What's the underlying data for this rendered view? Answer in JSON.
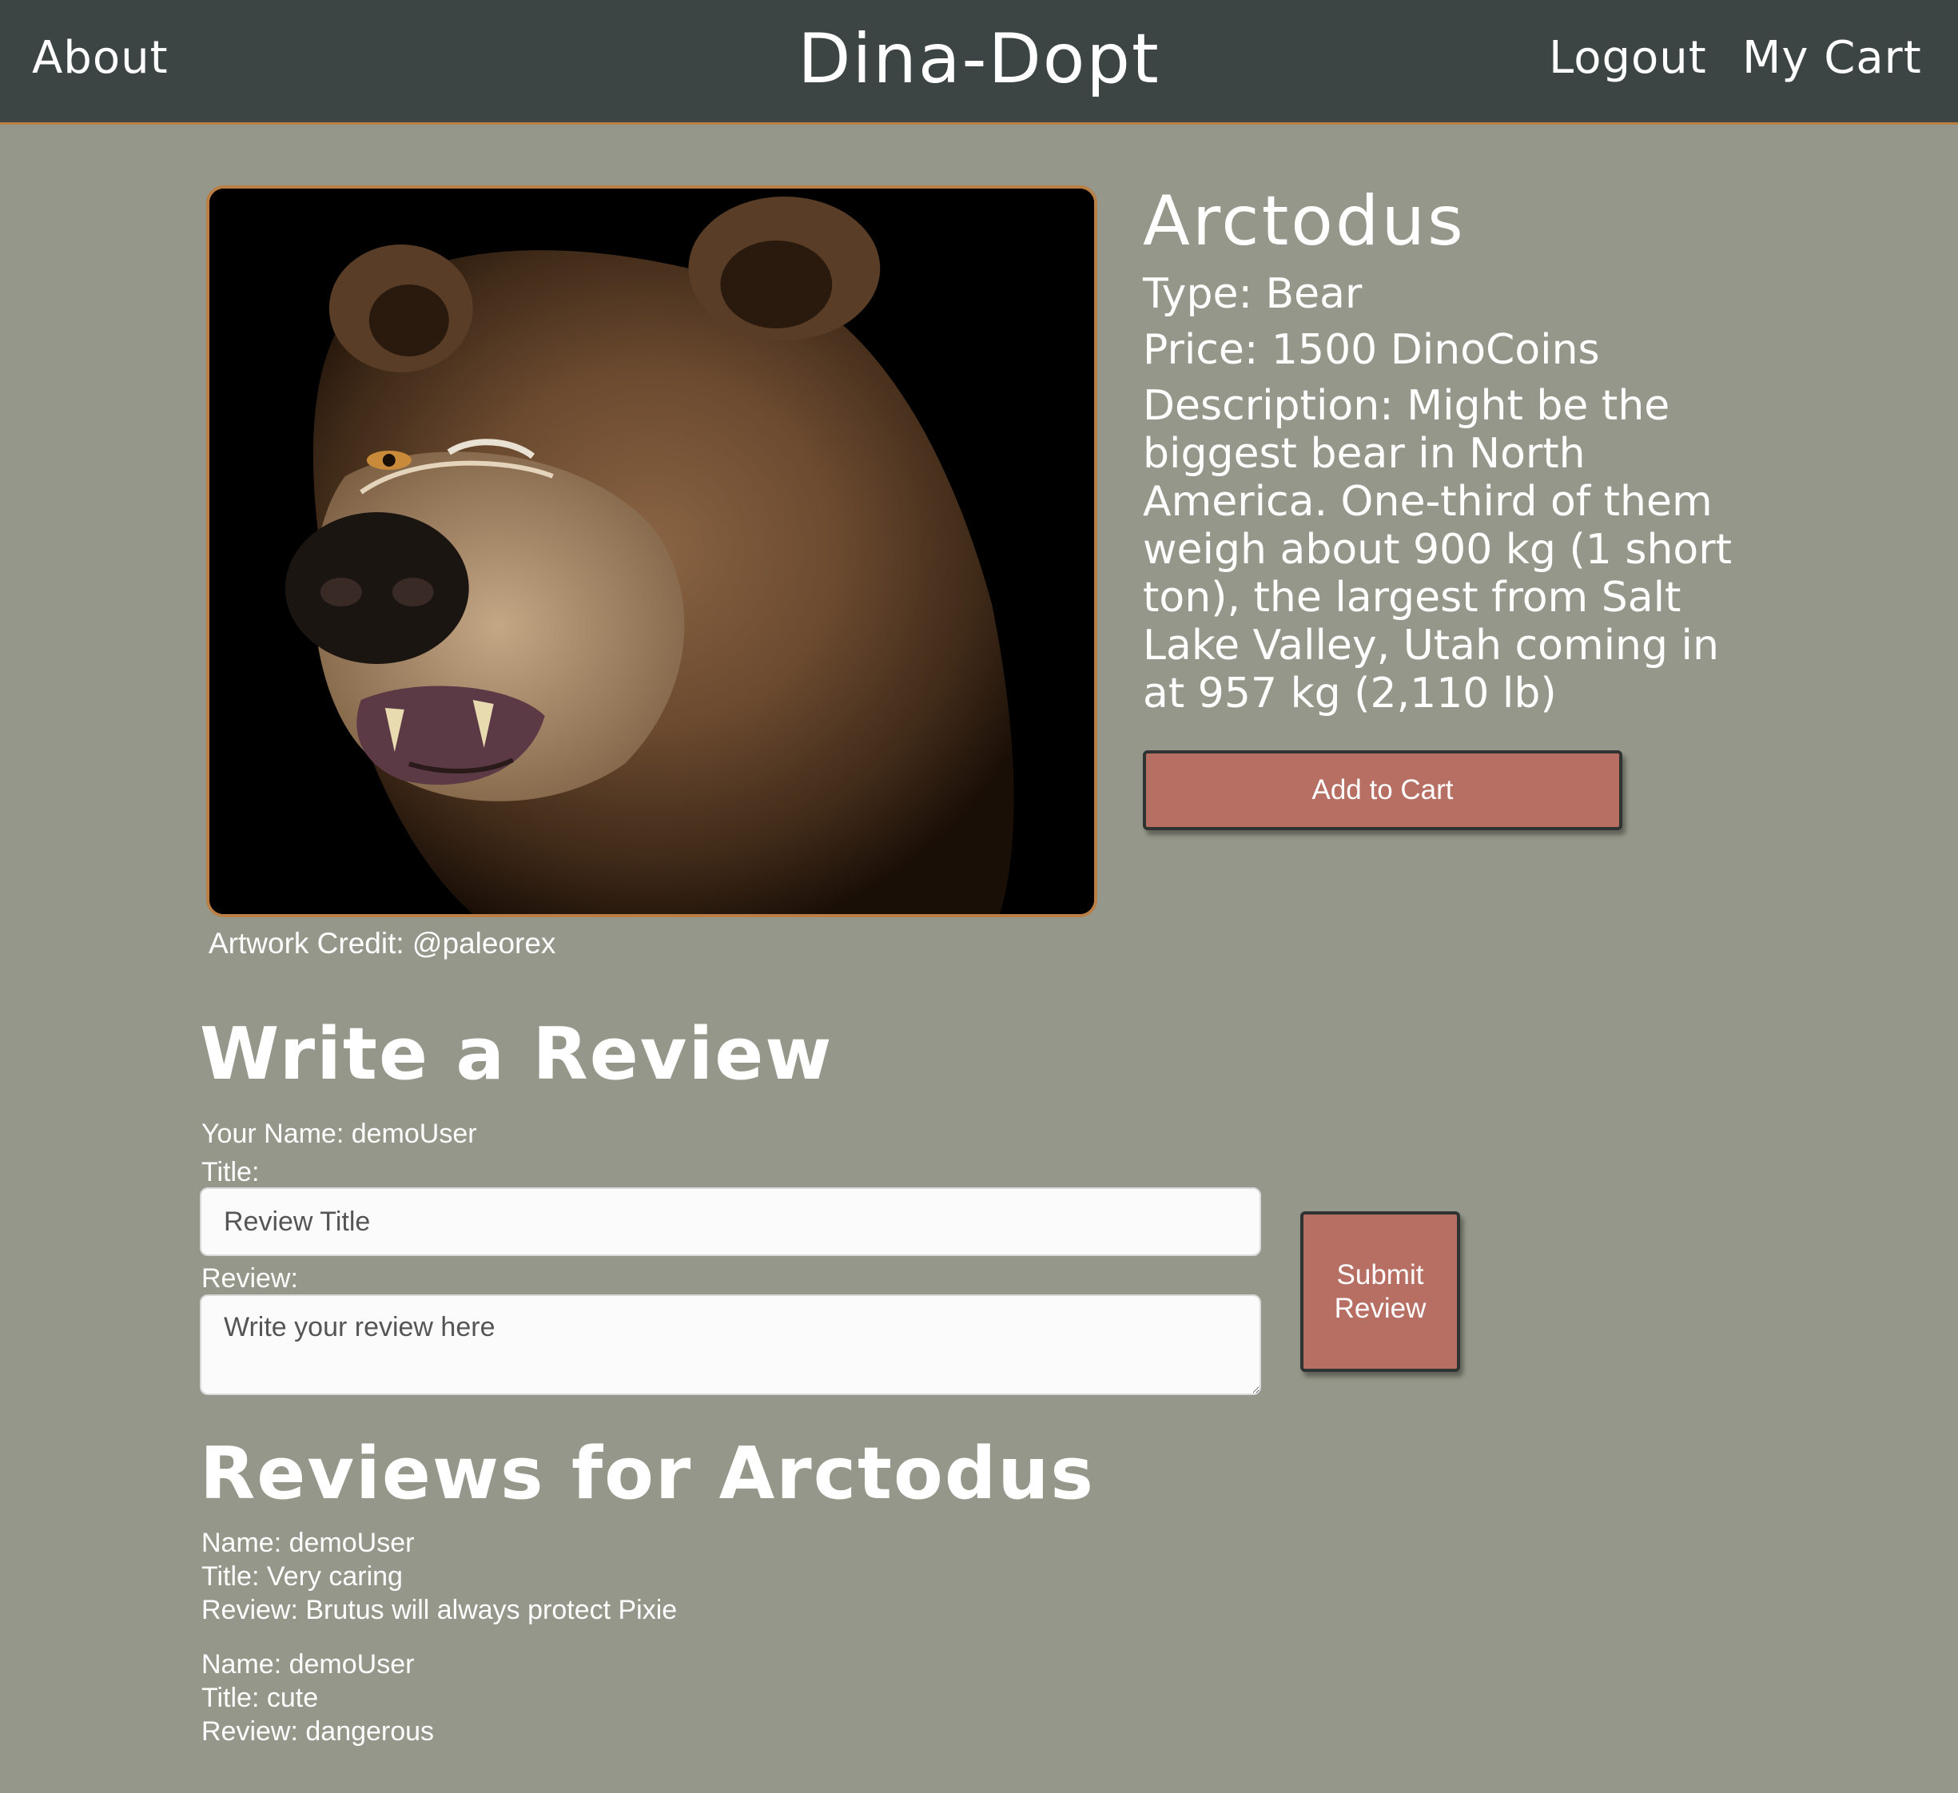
{
  "nav": {
    "about": "About",
    "brand": "Dina-Dopt",
    "logout": "Logout",
    "cart": "My Cart"
  },
  "dino": {
    "name": "Arctodus",
    "type": "Type: Bear",
    "price": "Price: 1500 DinoCoins",
    "description": "Description: Might be the biggest bear in North America. One-third of them weigh about 900 kg (1 short ton), the largest from Salt Lake Valley, Utah coming in at 957 kg (2,110 lb)",
    "credit": "Artwork Credit: @paleorex",
    "add_to_cart": "Add to Cart"
  },
  "review_form": {
    "heading": "Write a Review",
    "your_name": "Your Name: demoUser",
    "title_label": "Title:",
    "title_placeholder": "Review Title",
    "review_label": "Review:",
    "review_placeholder": "Write your review here",
    "submit": "Submit\nReview"
  },
  "reviews": {
    "heading": "Reviews for Arctodus",
    "items": [
      {
        "name": "Name: demoUser",
        "title": "Title: Very caring",
        "review": "Review: Brutus will always protect Pixie"
      },
      {
        "name": "Name: demoUser",
        "title": "Title: cute",
        "review": "Review: dangerous"
      }
    ]
  },
  "colors": {
    "background": "#949789",
    "navbar": "#3d4544",
    "accent_border": "#b97f45",
    "button": "#b86f63"
  }
}
